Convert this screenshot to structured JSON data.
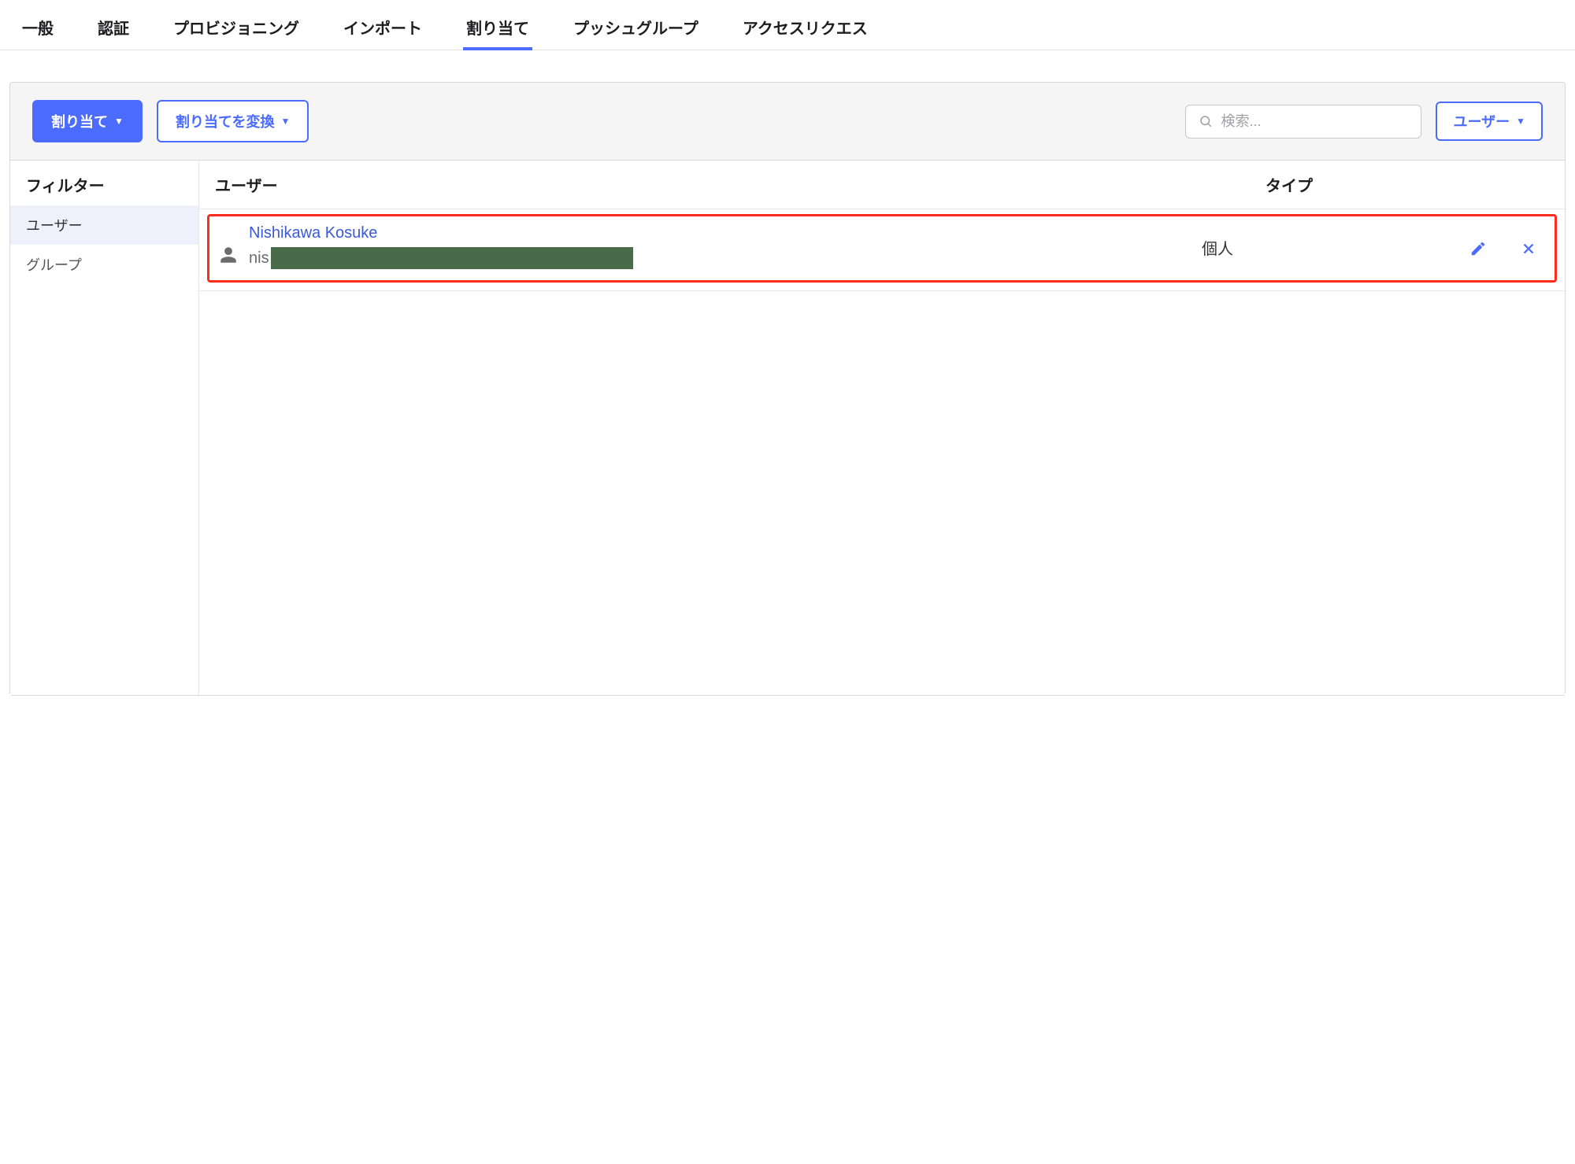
{
  "tabs": {
    "items": [
      {
        "label": "一般"
      },
      {
        "label": "認証"
      },
      {
        "label": "プロビジョニング"
      },
      {
        "label": "インポート"
      },
      {
        "label": "割り当て",
        "active": true
      },
      {
        "label": "プッシュグループ"
      },
      {
        "label": "アクセスリクエス"
      }
    ]
  },
  "toolbar": {
    "assign_label": "割り当て",
    "convert_label": "割り当てを変換",
    "search_placeholder": "検索...",
    "dropdown_label": "ユーザー"
  },
  "sidebar": {
    "title": "フィルター",
    "items": [
      {
        "label": "ユーザー",
        "active": true
      },
      {
        "label": "グループ"
      }
    ]
  },
  "table": {
    "header_user": "ユーザー",
    "header_type": "タイプ",
    "rows": [
      {
        "name": "Nishikawa Kosuke",
        "email_prefix": "nis",
        "type": "個人"
      }
    ]
  }
}
